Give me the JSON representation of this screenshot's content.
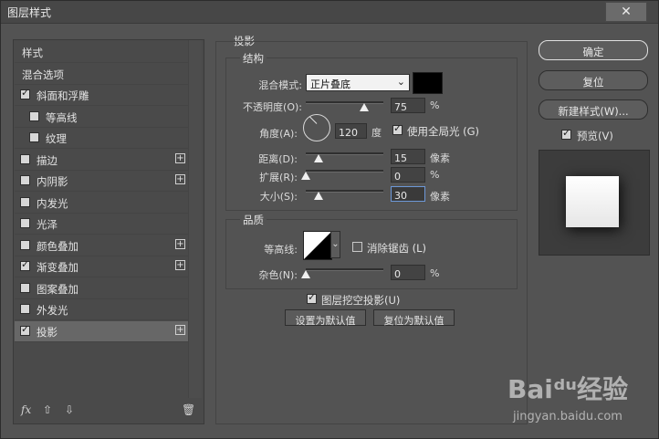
{
  "window": {
    "title": "图层样式",
    "close": "✕"
  },
  "sidebar": {
    "items": [
      {
        "label": "样式",
        "checkbox": null,
        "plus": false
      },
      {
        "label": "混合选项",
        "checkbox": null,
        "plus": false
      },
      {
        "label": "斜面和浮雕",
        "checkbox": true,
        "plus": false
      },
      {
        "label": "等高线",
        "checkbox": false,
        "plus": false,
        "sub": true
      },
      {
        "label": "纹理",
        "checkbox": false,
        "plus": false,
        "sub": true
      },
      {
        "label": "描边",
        "checkbox": false,
        "plus": true
      },
      {
        "label": "内阴影",
        "checkbox": false,
        "plus": true
      },
      {
        "label": "内发光",
        "checkbox": false,
        "plus": false
      },
      {
        "label": "光泽",
        "checkbox": false,
        "plus": false
      },
      {
        "label": "颜色叠加",
        "checkbox": false,
        "plus": true
      },
      {
        "label": "渐变叠加",
        "checkbox": true,
        "plus": true
      },
      {
        "label": "图案叠加",
        "checkbox": false,
        "plus": false
      },
      {
        "label": "外发光",
        "checkbox": false,
        "plus": false
      },
      {
        "label": "投影",
        "checkbox": true,
        "plus": true,
        "selected": true
      }
    ],
    "footer": {
      "fx": "fx",
      "up": "⇧",
      "down": "⇩",
      "trash": "🗑"
    }
  },
  "drop_shadow": {
    "section_title": "投影",
    "structure_title": "结构",
    "blend_mode_label": "混合模式:",
    "blend_mode_value": "正片叠底",
    "shadow_color": "#000000",
    "opacity_label": "不透明度(O):",
    "opacity_value": "75",
    "opacity_unit": "%",
    "opacity_fraction": 0.75,
    "angle_label": "角度(A):",
    "angle_value": "120",
    "angle_unit": "度",
    "global_light_label": "使用全局光 (G)",
    "global_light_checked": true,
    "distance_label": "距离(D):",
    "distance_value": "15",
    "distance_unit": "像素",
    "spread_label": "扩展(R):",
    "spread_value": "0",
    "spread_unit": "%",
    "size_label": "大小(S):",
    "size_value": "30",
    "size_unit": "像素",
    "quality_title": "品质",
    "contour_label": "等高线:",
    "antialias_label": "消除锯齿 (L)",
    "antialias_checked": false,
    "noise_label": "杂色(N):",
    "noise_value": "0",
    "noise_unit": "%",
    "knockout_label": "图层挖空投影(U)",
    "knockout_checked": true,
    "make_default": "设置为默认值",
    "reset_default": "复位为默认值"
  },
  "buttons": {
    "ok": "确定",
    "reset": "复位",
    "new_style": "新建样式(W)...",
    "preview_label": "预览(V)",
    "preview_checked": true
  },
  "watermark": {
    "logo": "Baiᵈᵘ经验",
    "url": "jingyan.baidu.com"
  }
}
